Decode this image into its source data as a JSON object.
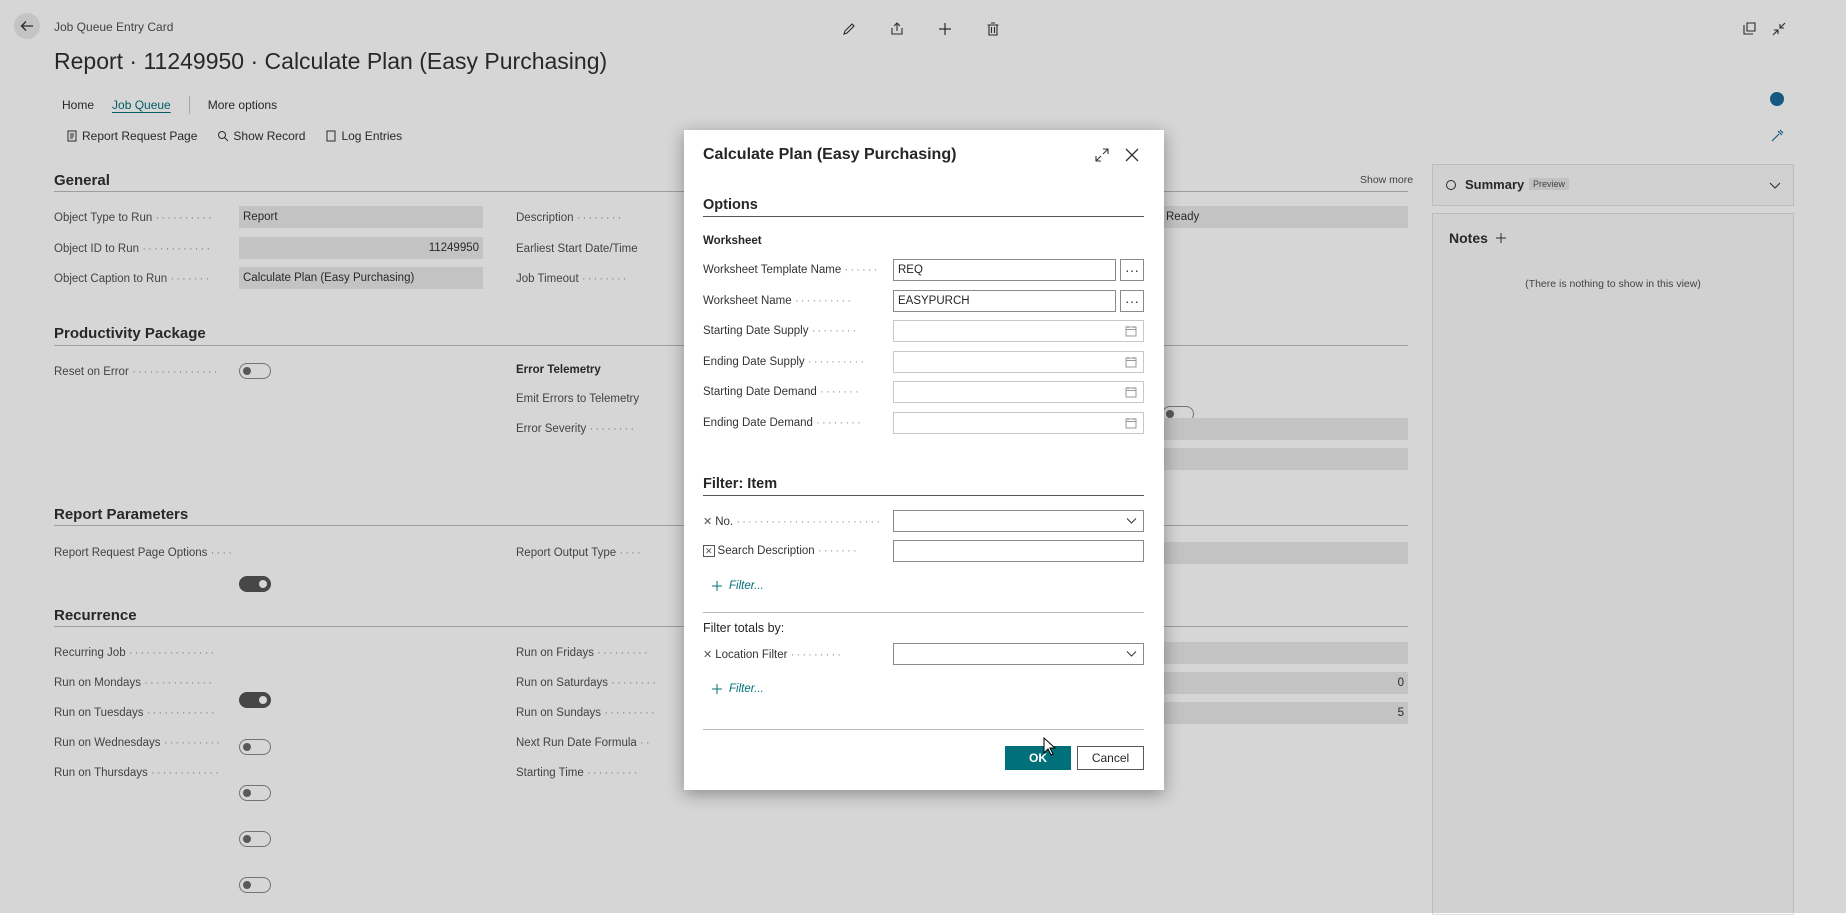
{
  "page": {
    "breadcrumb": "Job Queue Entry Card",
    "title": "Report · 11249950 · Calculate Plan (Easy Purchasing)",
    "nav": {
      "home": "Home",
      "job_queue": "Job Queue",
      "more_options": "More options"
    },
    "actions": {
      "report_request_page": "Report Request Page",
      "show_record": "Show Record",
      "log_entries": "Log Entries"
    },
    "show_more": "Show more",
    "general": {
      "title": "General",
      "object_type_label": "Object Type to Run",
      "object_type_value": "Report",
      "object_id_label": "Object ID to Run",
      "object_id_value": "11249950",
      "object_caption_label": "Object Caption to Run",
      "object_caption_value": "Calculate Plan (Easy Purchasing)",
      "description_label": "Description",
      "earliest_start_label": "Earliest Start Date/Time",
      "job_timeout_label": "Job Timeout",
      "status_value": "Ready"
    },
    "productivity": {
      "title": "Productivity Package",
      "reset_on_error_label": "Reset on Error",
      "error_telemetry_heading": "Error Telemetry",
      "emit_errors_label": "Emit Errors to Telemetry",
      "error_severity_label": "Error Severity"
    },
    "report_params": {
      "title": "Report Parameters",
      "request_page_options_label": "Report Request Page Options",
      "output_type_label": "Report Output Type"
    },
    "recurrence": {
      "title": "Recurrence",
      "recurring_job_label": "Recurring Job",
      "mondays_label": "Run on Mondays",
      "tuesdays_label": "Run on Tuesdays",
      "wednesdays_label": "Run on Wednesdays",
      "thursdays_label": "Run on Thursdays",
      "fridays_label": "Run on Fridays",
      "saturdays_label": "Run on Saturdays",
      "sundays_label": "Run on Sundays",
      "next_run_formula_label": "Next Run Date Formula",
      "starting_time_label": "Starting Time",
      "value_0": "0",
      "value_5": "5"
    },
    "factbox": {
      "summary_title": "Summary",
      "preview_badge": "Preview",
      "notes_title": "Notes",
      "empty_text": "(There is nothing to show in this view)"
    }
  },
  "dialog": {
    "title": "Calculate Plan (Easy Purchasing)",
    "options_title": "Options",
    "worksheet_subtitle": "Worksheet",
    "fields": {
      "template_name_label": "Worksheet Template Name",
      "template_name_value": "REQ",
      "worksheet_name_label": "Worksheet Name",
      "worksheet_name_value": "EASYPURCH",
      "start_supply_label": "Starting Date Supply",
      "end_supply_label": "Ending Date Supply",
      "start_demand_label": "Starting Date Demand",
      "end_demand_label": "Ending Date Demand"
    },
    "filter_item_title": "Filter: Item",
    "no_label": "No.",
    "search_desc_label": "Search Description",
    "add_filter": "Filter...",
    "filter_totals_title": "Filter totals by:",
    "location_filter_label": "Location Filter",
    "ok_label": "OK",
    "cancel_label": "Cancel"
  },
  "colors": {
    "accent": "#00707a",
    "overlay": "rgba(0,0,0,0.16)"
  }
}
